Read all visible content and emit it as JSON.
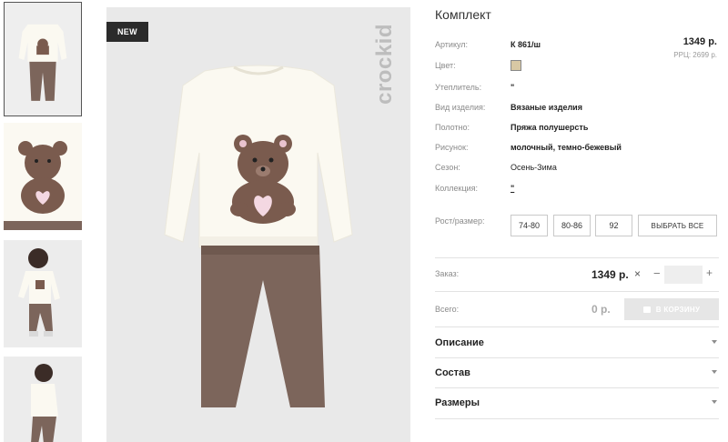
{
  "gallery": {
    "badge": "NEW",
    "brand": "crockid"
  },
  "product": {
    "title": "Комплект",
    "price": "1349 р.",
    "rrp": "РРЦ: 2699 р.",
    "attributes": [
      {
        "label": "Артикул:",
        "value": "К 861/ш"
      },
      {
        "label": "Цвет:",
        "value": ""
      },
      {
        "label": "Утеплитель:",
        "value": "\""
      },
      {
        "label": "Вид изделия:",
        "value": "Вязаные изделия"
      },
      {
        "label": "Полотно:",
        "value": "Пряжа полушерсть"
      },
      {
        "label": "Рисунок:",
        "value": "молочный, темно-бежевый"
      },
      {
        "label": "Сезон:",
        "value": "Осень-Зима"
      },
      {
        "label": "Коллекция:",
        "value": "\""
      }
    ],
    "swatch_color": "#d8c8a4",
    "sizes_label": "Рост/размер:",
    "sizes": [
      "74-80",
      "80-86",
      "92"
    ],
    "select_all": "ВЫБРАТЬ ВСЕ"
  },
  "order": {
    "label": "Заказ:",
    "price": "1349 р.",
    "times": "×",
    "minus": "−",
    "plus": "+",
    "quantity": ""
  },
  "total": {
    "label": "Всего:",
    "value": "0 р.",
    "cart_button": "В КОРЗИНУ"
  },
  "accordion": [
    {
      "title": "Описание"
    },
    {
      "title": "Состав"
    },
    {
      "title": "Размеры"
    }
  ]
}
